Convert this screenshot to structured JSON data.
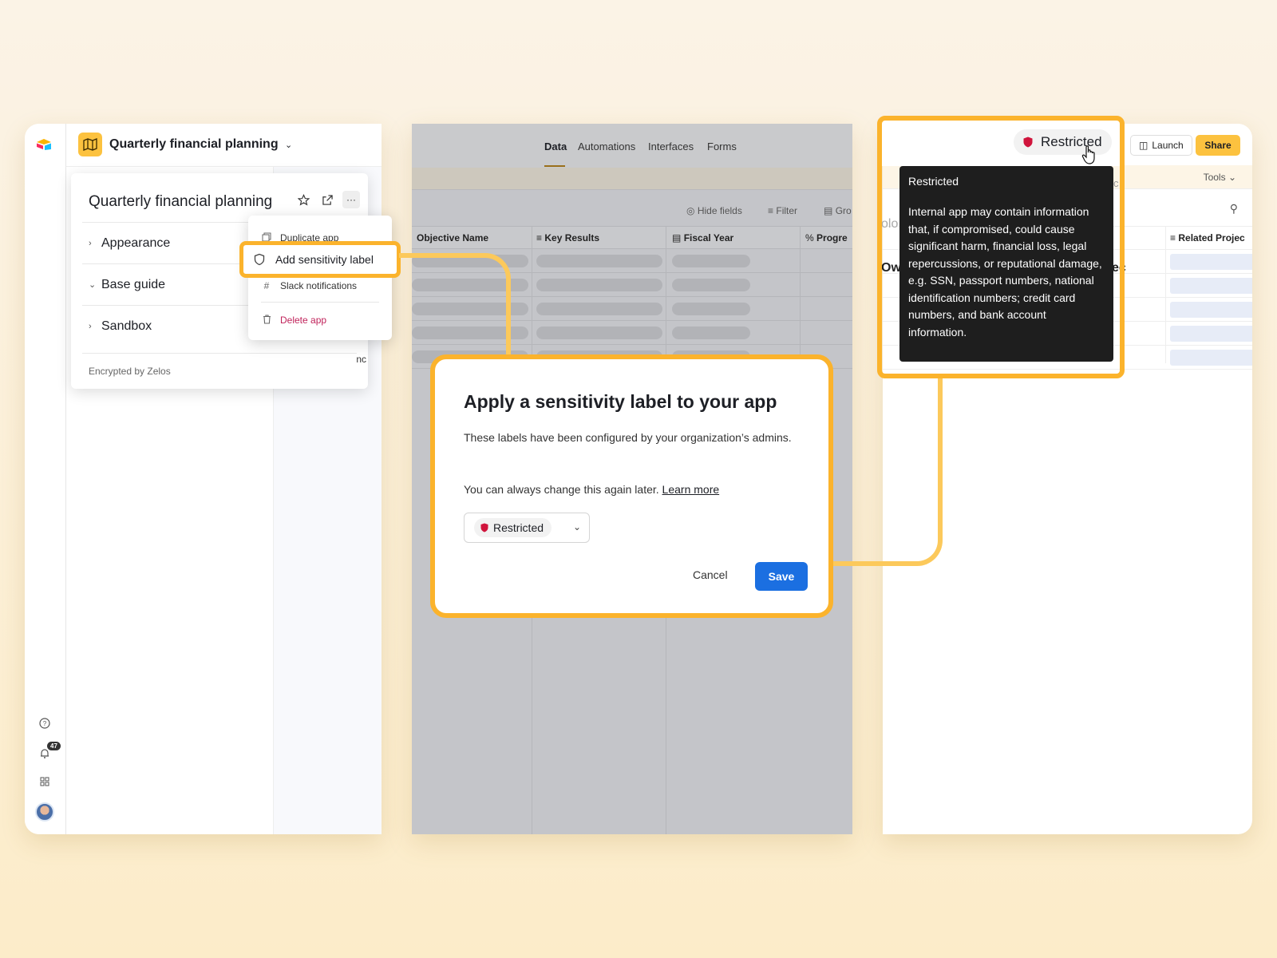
{
  "left_panel": {
    "app_name": "Quarterly financial planning",
    "card": {
      "title": "Quarterly financial planning",
      "sections": [
        "Appearance",
        "Base guide",
        "Sandbox"
      ],
      "footer": "Encrypted by Zelos",
      "partial_right": "nc"
    },
    "menu": {
      "items": [
        "Duplicate app",
        "Add sensitivity label",
        "Slack notifications",
        "Delete app"
      ]
    },
    "notifications_count": "47"
  },
  "center_panel": {
    "tabs": [
      "Data",
      "Automations",
      "Interfaces",
      "Forms"
    ],
    "active_tab": "Data",
    "toolbar": [
      "Hide fields",
      "Filter",
      "Gro"
    ],
    "columns": [
      "Objective Name",
      "Key Results",
      "Fiscal Year",
      "Progre"
    ]
  },
  "modal": {
    "title": "Apply a sensitivity label to your app",
    "description": "These labels have been configured by your organization’s admins.",
    "note": "You can always change this again later.",
    "learn_more": "Learn more",
    "selected_label": "Restricted",
    "cancel": "Cancel",
    "save": "Save"
  },
  "right_panel": {
    "label_pill": "Restricted",
    "launch": "Launch",
    "share": "Share",
    "tools": "Tools",
    "related_col": "Related Projec",
    "partial_texts": [
      "olo",
      "Ow",
      "ec",
      "c"
    ],
    "tooltip": {
      "title": "Restricted",
      "body": "Internal app may contain information that, if compromised, could cause significant harm, financial loss, legal repercussions, or reputational damage, e.g. SSN, passport numbers, national identification numbers; credit card numbers, and bank account information."
    }
  },
  "colors": {
    "highlight": "#fbb32c",
    "accent_yellow": "#fcc23f",
    "primary_blue": "#1b6fe1",
    "danger": "#c0225a",
    "restricted_red": "#d0143c"
  }
}
